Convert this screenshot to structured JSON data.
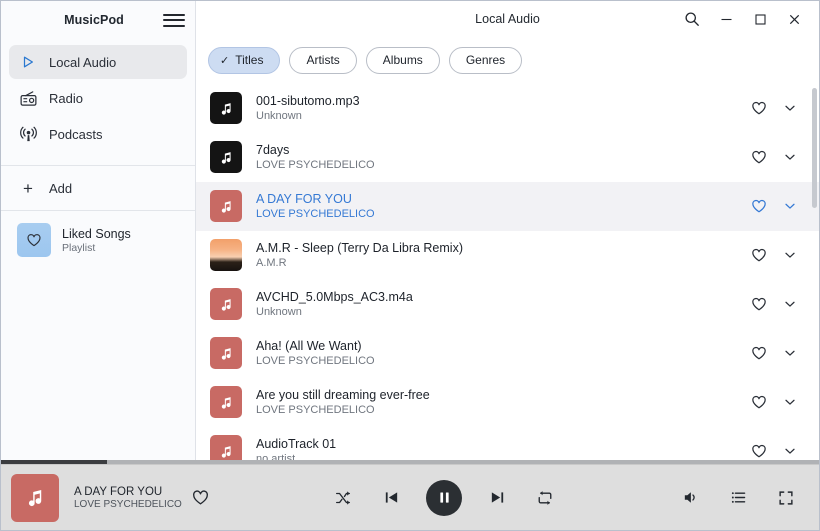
{
  "window": {
    "app_title": "MusicPod",
    "page_title": "Local Audio",
    "controls": {
      "search": "search-icon",
      "minimize": "minimize-icon",
      "maximize": "maximize-icon",
      "close": "close-icon"
    }
  },
  "sidebar": {
    "menu_button": "hamburger-icon",
    "items": [
      {
        "label": "Local Audio",
        "icon": "play-triangle-icon",
        "selected": true
      },
      {
        "label": "Radio",
        "icon": "radio-icon",
        "selected": false
      },
      {
        "label": "Podcasts",
        "icon": "podcast-icon",
        "selected": false
      }
    ],
    "add_label": "Add",
    "playlist": {
      "name": "Liked Songs",
      "subtitle": "Playlist",
      "icon": "heart-icon"
    }
  },
  "filters": {
    "chips": [
      {
        "label": "Titles",
        "active": true
      },
      {
        "label": "Artists",
        "active": false
      },
      {
        "label": "Albums",
        "active": false
      },
      {
        "label": "Genres",
        "active": false
      }
    ],
    "check_glyph": "✓"
  },
  "tracks": [
    {
      "title": "001-sibutomo.mp3",
      "artist": "Unknown",
      "art": "dark",
      "selected": false
    },
    {
      "title": "7days",
      "artist": "LOVE PSYCHEDELICO",
      "art": "dark",
      "selected": false
    },
    {
      "title": "A DAY FOR YOU",
      "artist": "LOVE PSYCHEDELICO",
      "art": "red",
      "selected": true
    },
    {
      "title": "A.M.R - Sleep (Terry Da Libra Remix)",
      "artist": "A.M.R",
      "art": "image",
      "selected": false
    },
    {
      "title": "AVCHD_5.0Mbps_AC3.m4a",
      "artist": "Unknown",
      "art": "red",
      "selected": false
    },
    {
      "title": "Aha! (All We Want)",
      "artist": "LOVE PSYCHEDELICO",
      "art": "red",
      "selected": false
    },
    {
      "title": "Are you still dreaming ever-free",
      "artist": "LOVE PSYCHEDELICO",
      "art": "red",
      "selected": false
    },
    {
      "title": "AudioTrack 01",
      "artist": "no artist",
      "art": "red",
      "selected": false
    }
  ],
  "row_actions": {
    "like": "heart-icon",
    "more": "chevron-down-icon"
  },
  "player": {
    "now_playing": {
      "title": "A DAY FOR YOU",
      "artist": "LOVE PSYCHEDELICO",
      "art": "music-note-icon",
      "like": "heart-icon"
    },
    "progress_percent": 13,
    "controls": [
      {
        "name": "shuffle-button",
        "icon": "shuffle-icon"
      },
      {
        "name": "previous-button",
        "icon": "skip-previous-icon"
      },
      {
        "name": "play-pause-button",
        "icon": "pause-icon"
      },
      {
        "name": "next-button",
        "icon": "skip-next-icon"
      },
      {
        "name": "repeat-button",
        "icon": "repeat-icon"
      }
    ],
    "right_controls": [
      {
        "name": "volume-button",
        "icon": "volume-icon"
      },
      {
        "name": "queue-button",
        "icon": "playlist-queue-icon"
      },
      {
        "name": "fullscreen-button",
        "icon": "fullscreen-icon"
      }
    ]
  },
  "colors": {
    "accent_blue": "#3579d4",
    "chip_active": "#cddcf2",
    "art_red": "#c86a64",
    "player_bg": "#dedede"
  }
}
